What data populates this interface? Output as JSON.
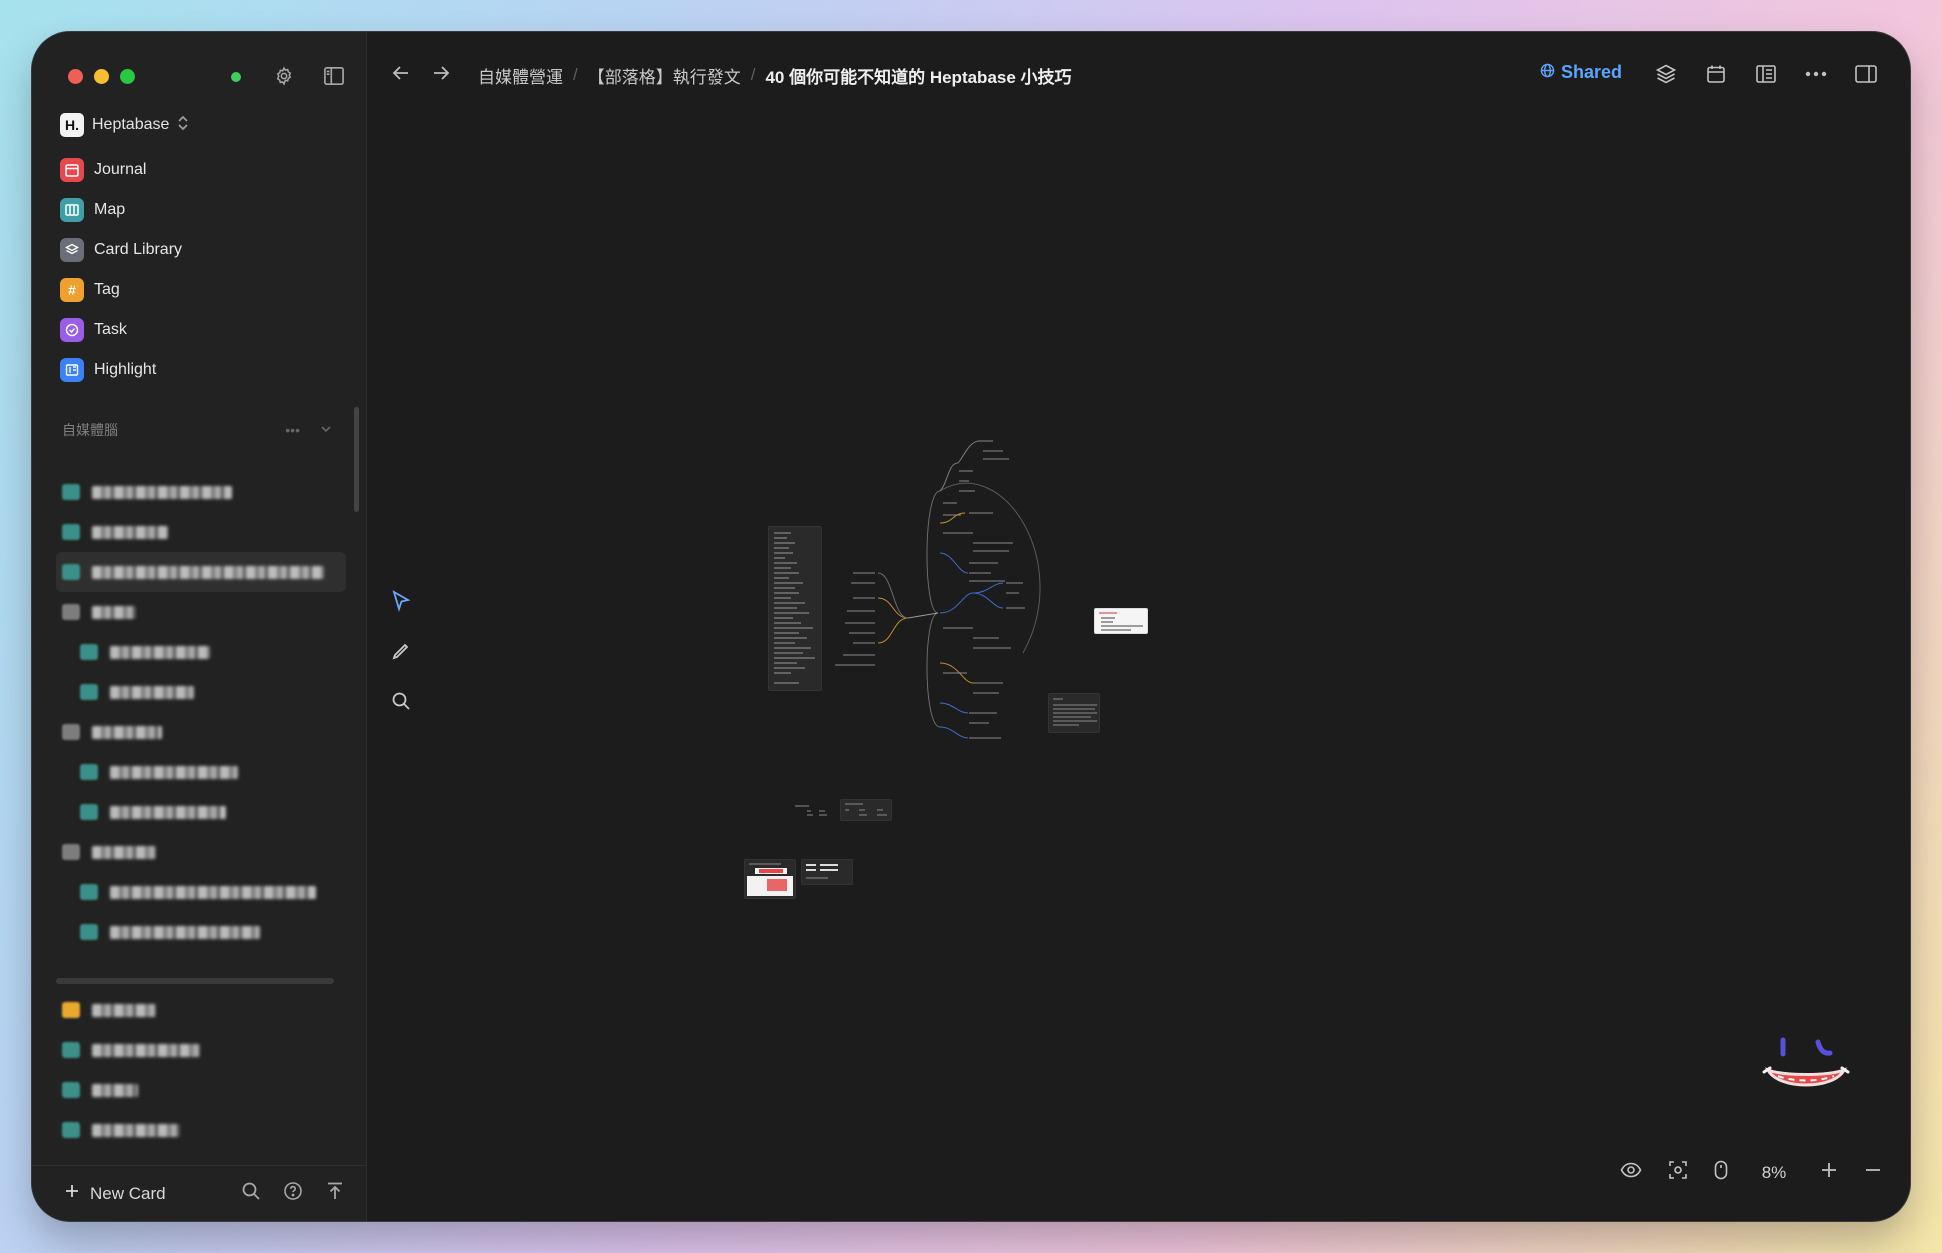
{
  "app": {
    "workspace_name": "Heptabase",
    "workspace_initial": "H."
  },
  "sidebar": {
    "nav_items": [
      {
        "label": "Journal",
        "icon": "calendar-icon",
        "color": "#e5484d"
      },
      {
        "label": "Map",
        "icon": "map-icon",
        "color": "#3e9fa6"
      },
      {
        "label": "Card Library",
        "icon": "stack-icon",
        "color": "#6b6e78"
      },
      {
        "label": "Tag",
        "icon": "hash-icon",
        "color": "#f0a030"
      },
      {
        "label": "Task",
        "icon": "check-circle-icon",
        "color": "#9b5de5"
      },
      {
        "label": "Highlight",
        "icon": "highlight-icon",
        "color": "#3b82f6"
      }
    ],
    "section_title": "自媒體腦",
    "new_card_label": "New Card"
  },
  "topbar": {
    "breadcrumbs": [
      "自媒體營運",
      "【部落格】執行發文",
      "40 個你可能不知道的 Heptabase 小技巧"
    ],
    "separator": "/",
    "shared_label": "Shared",
    "accent_color": "#5aa5ff"
  },
  "canvas": {
    "zoom_label": "8%"
  }
}
